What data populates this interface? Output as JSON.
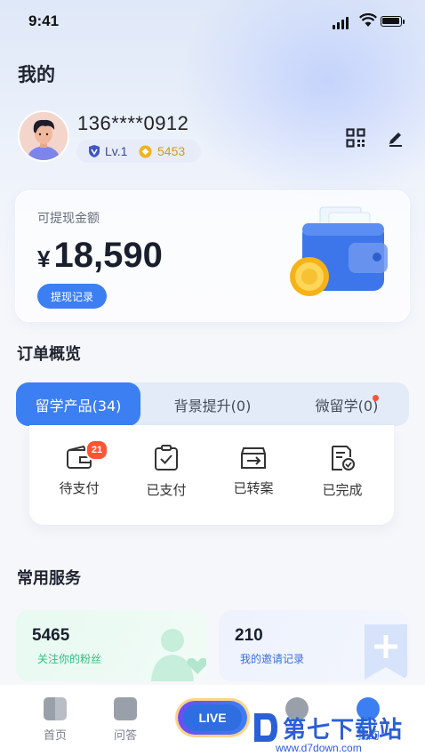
{
  "status": {
    "time": "9:41"
  },
  "page": {
    "title": "我的"
  },
  "profile": {
    "phone": "136****0912",
    "level": "Lv.1",
    "points": "5453"
  },
  "balance": {
    "label": "可提现金额",
    "currency": "¥",
    "amount": "18,590",
    "history_button": "提现记录"
  },
  "orders": {
    "title": "订单概览",
    "tabs": [
      "留学产品(34)",
      "背景提升(0)",
      "微留学(0)"
    ],
    "actions": [
      {
        "label": "待支付",
        "icon": "wallet-icon",
        "badge": "21"
      },
      {
        "label": "已支付",
        "icon": "clipboard-check-icon"
      },
      {
        "label": "已转案",
        "icon": "box-transfer-icon"
      },
      {
        "label": "已完成",
        "icon": "document-check-icon"
      }
    ]
  },
  "services": {
    "title": "常用服务",
    "items": [
      {
        "count": "5465",
        "label": "关注你的粉丝",
        "color": "#2fbf7f"
      },
      {
        "count": "210",
        "label": "我的邀请记录",
        "color": "#3b6fd6"
      }
    ]
  },
  "tabbar": {
    "home": "首页",
    "qa": "问答",
    "live": "LIVE",
    "mine": "我的"
  },
  "watermark": {
    "brand": "第七下载站",
    "url": "www.d7down.com"
  },
  "colors": {
    "accent": "#3b7ff2",
    "badge": "#ff5533",
    "points": "#d39a14"
  }
}
